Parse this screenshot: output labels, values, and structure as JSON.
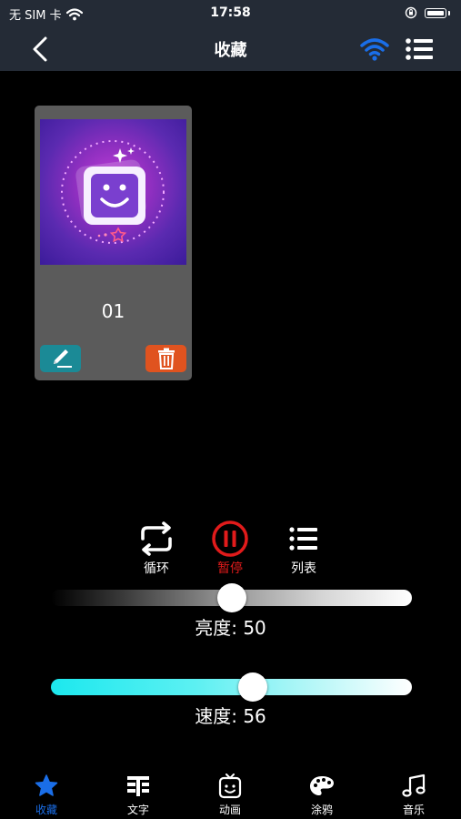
{
  "status": {
    "carrier": "无 SIM 卡",
    "time": "17:58"
  },
  "nav": {
    "title": "收藏"
  },
  "favorites": [
    {
      "label": "01"
    }
  ],
  "controls": {
    "loop_label": "循环",
    "pause_label": "暂停",
    "list_label": "列表"
  },
  "brightness": {
    "text": "亮度: 50",
    "value": 50,
    "max": 100
  },
  "speed": {
    "text": "速度: 56",
    "value": 56,
    "max": 100
  },
  "tabs": [
    {
      "label": "收藏",
      "icon": "star-icon",
      "active": true
    },
    {
      "label": "文字",
      "icon": "text-icon"
    },
    {
      "label": "动画",
      "icon": "animation-icon"
    },
    {
      "label": "涂鸦",
      "icon": "palette-icon"
    },
    {
      "label": "音乐",
      "icon": "music-icon"
    }
  ],
  "colors": {
    "bar_bg": "#242b36",
    "accent_blue": "#1a6ee8",
    "pause_red": "#e11b1b",
    "edit_teal": "#1b8a96",
    "delete_orange": "#e0531f",
    "speed_cyan": "#1ce8ee"
  }
}
